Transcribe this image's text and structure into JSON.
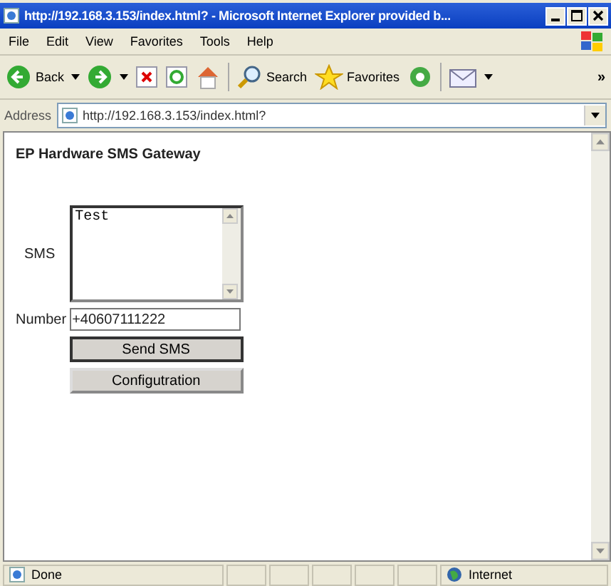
{
  "window": {
    "title": "http://192.168.3.153/index.html? - Microsoft Internet Explorer provided b..."
  },
  "menu": [
    "File",
    "Edit",
    "View",
    "Favorites",
    "Tools",
    "Help"
  ],
  "toolbar": {
    "back": "Back",
    "search": "Search",
    "favorites": "Favorites",
    "more": "»"
  },
  "address": {
    "label": "Address",
    "value": "http://192.168.3.153/index.html?"
  },
  "page": {
    "heading": "EP Hardware SMS Gateway",
    "sms_label": "SMS",
    "sms_value": "Test",
    "number_label": "Number",
    "number_value": "+40607111222",
    "buttons": [
      "Send SMS",
      "Configutration"
    ]
  },
  "status_bar": {
    "text": "Done",
    "zone": "Internet"
  }
}
